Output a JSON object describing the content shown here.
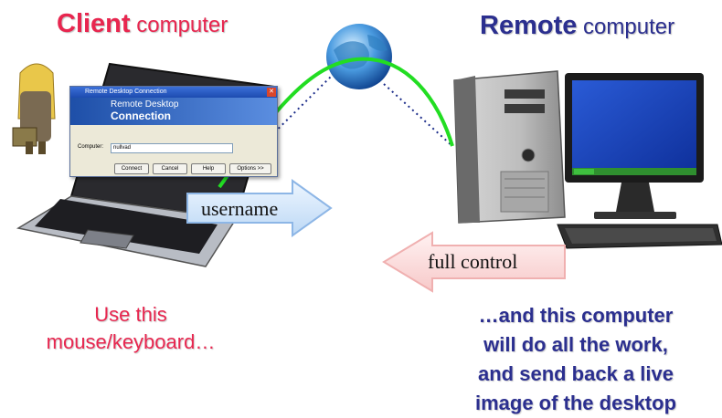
{
  "headings": {
    "client_bold": "Client",
    "client_rest": " computer",
    "remote_bold": "Remote",
    "remote_rest": " computer"
  },
  "arrows": {
    "username": "username",
    "full_control": "full control"
  },
  "captions": {
    "client_line1": "Use this",
    "client_line2": "mouse/keyboard…",
    "remote_line1": "…and this computer",
    "remote_line2": "will do all the work,",
    "remote_line3": "and send back a live",
    "remote_line4": "image of the desktop"
  },
  "rdc_dialog": {
    "title": "Remote Desktop Connection",
    "banner_line1": "Remote Desktop",
    "banner_line2": "Connection",
    "computer_label": "Computer:",
    "computer_value": "nullvad",
    "buttons": [
      "Connect",
      "Cancel",
      "Help",
      "Options >>"
    ]
  },
  "colors": {
    "client": "#e8264f",
    "remote": "#2b2f8f",
    "connection_line": "#22dd22",
    "arrow_right": "#cfe3f8",
    "arrow_left": "#fbd6d6"
  }
}
